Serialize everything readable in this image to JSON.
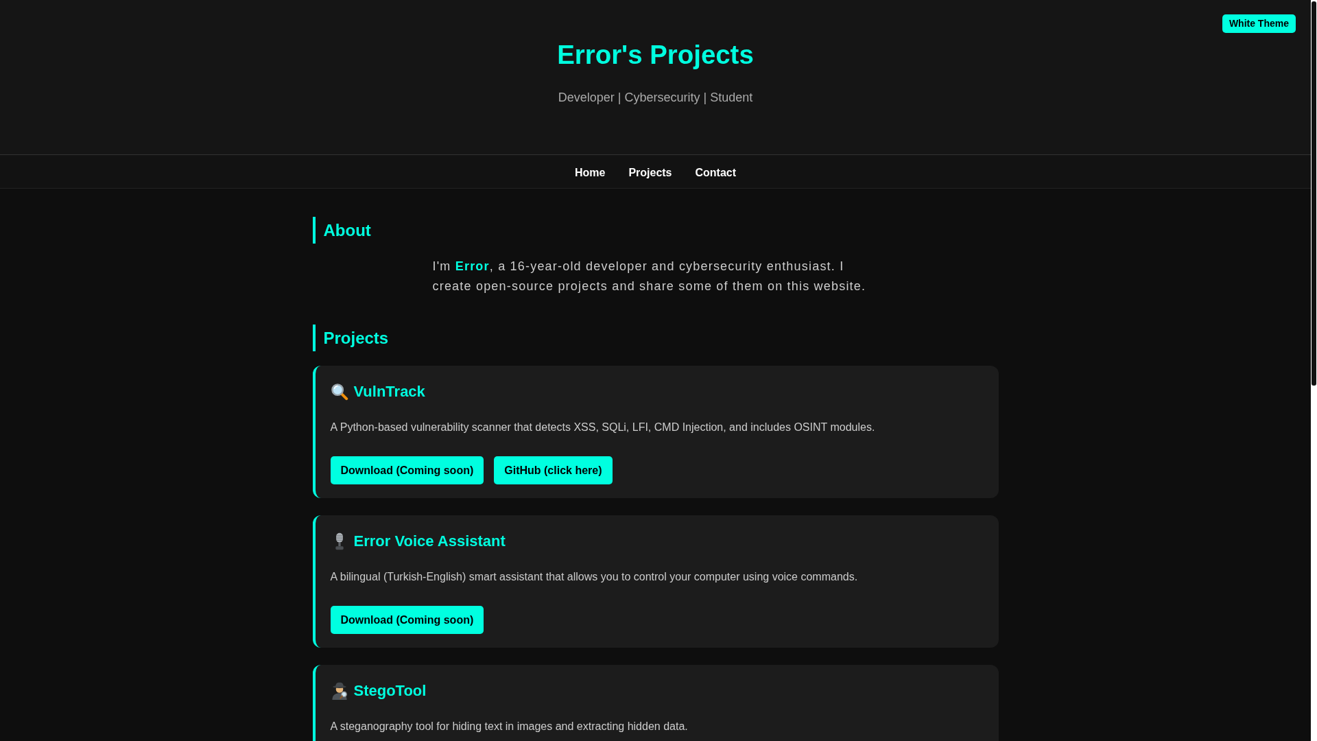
{
  "theme_button": {
    "label": "White Theme"
  },
  "header": {
    "title": "Error's Projects",
    "subtitle": "Developer | Cybersecurity | Student"
  },
  "nav": [
    {
      "label": "Home"
    },
    {
      "label": "Projects"
    },
    {
      "label": "Contact"
    }
  ],
  "about": {
    "heading": "About",
    "text": "I'm **Error**, a 16-year-old developer and cybersecurity enthusiast. I create open-source projects and share some of them on this website."
  },
  "projects": {
    "heading": "Projects",
    "items": [
      {
        "title": "VulnTrack",
        "description": "A Python-based vulnerability scanner that detects XSS, SQLi, LFI, CMD Injection, and includes OSINT modules.",
        "buttons": [
          "Download (Coming soon)",
          "GitHub (click here)"
        ]
      },
      {
        "title": "Error Voice Assistant",
        "description": "A bilingual (Turkish-English) smart assistant that allows you to control your computer using voice commands.",
        "buttons": [
          "Download (Coming soon)"
        ]
      },
      {
        "title": "StegoTool",
        "description": "A steganography tool for hiding text in images and extracting hidden data."
      }
    ]
  }
}
